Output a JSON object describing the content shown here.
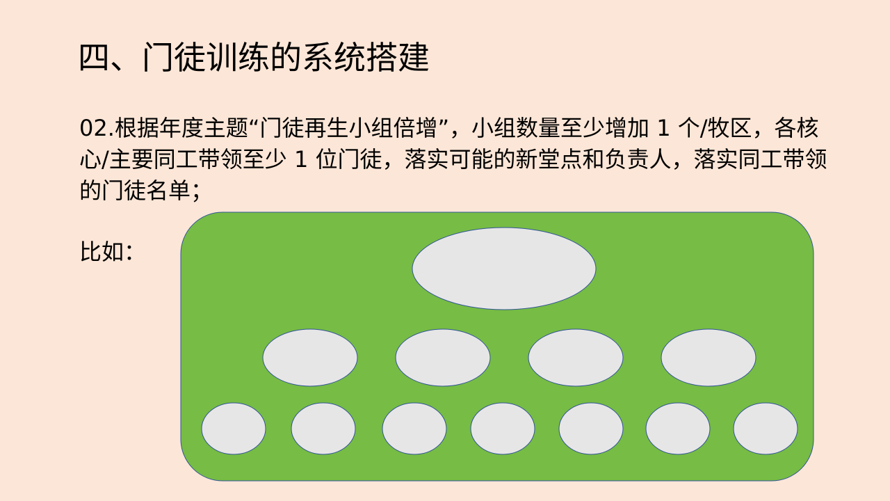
{
  "slide": {
    "title": "四、门徒训练的系统搭建",
    "body": "02.根据年度主题“门徒再生小组倍增”，小组数量至少增加 1 个/牧区，各核心/主要同工带领至少 1 位门徒，落实可能的新堂点和负责人，落实同工带领的门徒名单；",
    "example_label": "比如："
  },
  "diagram": {
    "type": "hierarchy",
    "levels": [
      {
        "level": 1,
        "count": 1
      },
      {
        "level": 2,
        "count": 4
      },
      {
        "level": 3,
        "count": 7
      }
    ],
    "colors": {
      "background": "#fce6d7",
      "container_fill": "#77bc44",
      "container_stroke": "#2f5597",
      "node_fill": "#e7e6e6",
      "node_stroke": "#2f5597"
    }
  }
}
